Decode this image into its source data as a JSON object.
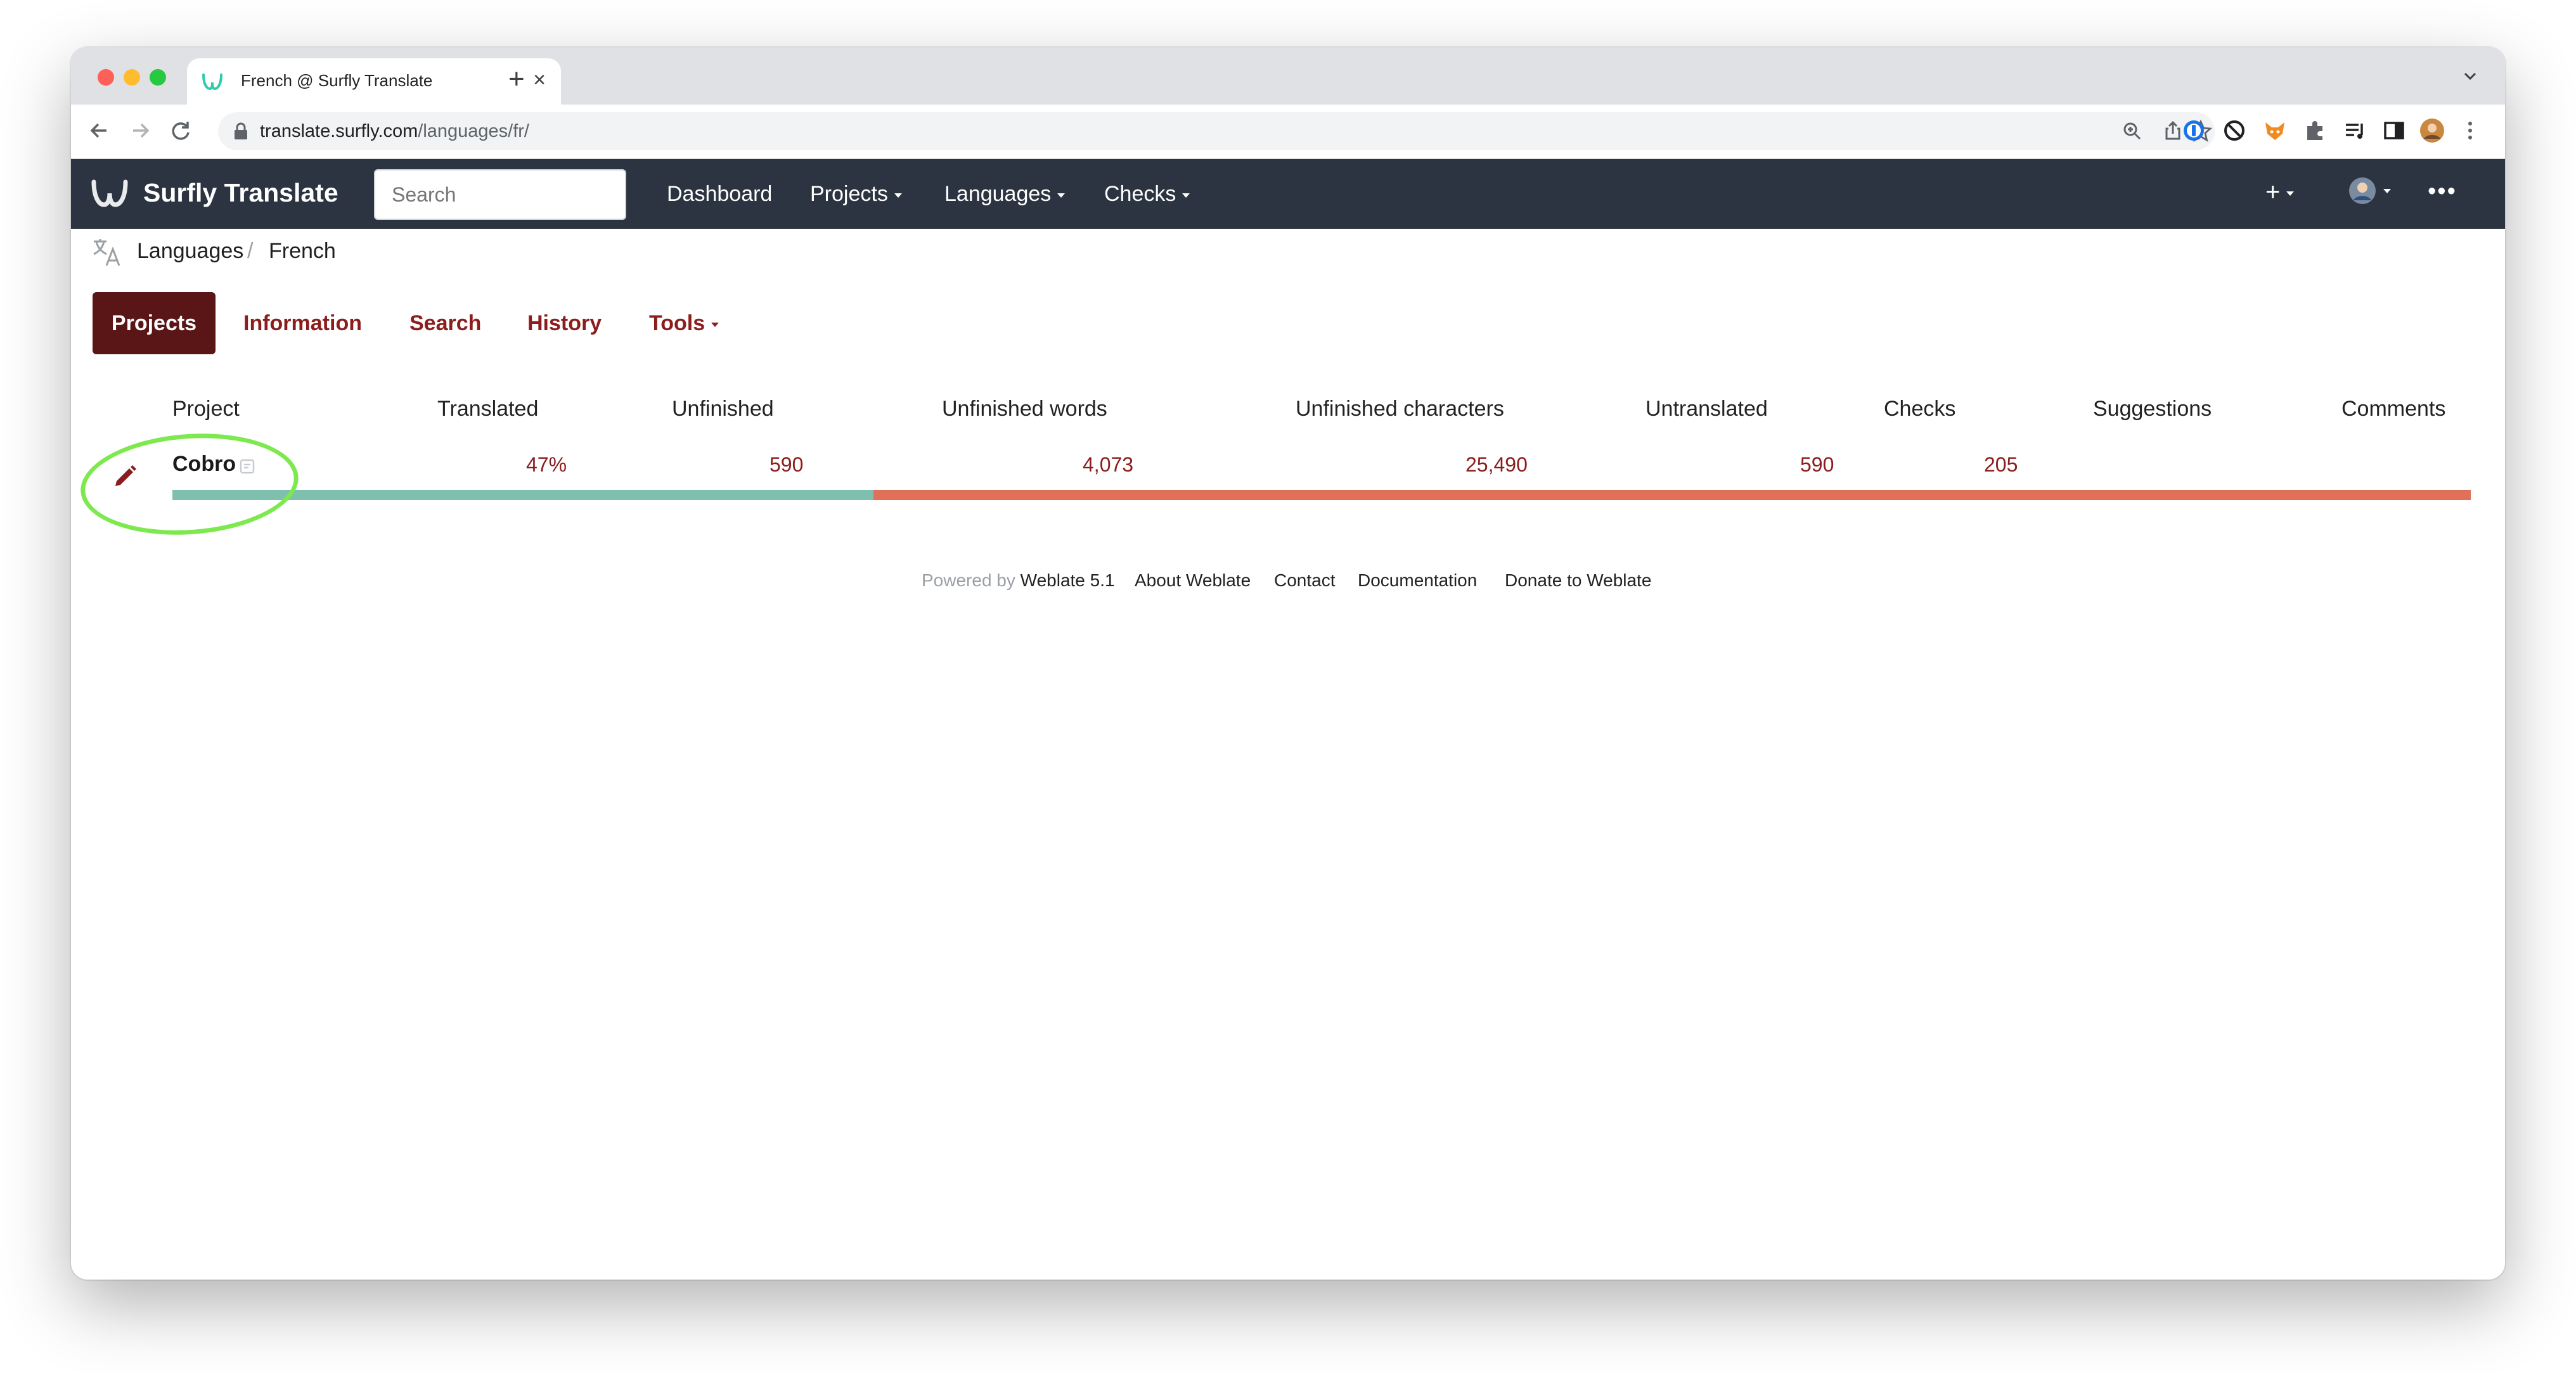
{
  "browser": {
    "tab_title": "French @ Surfly Translate",
    "new_tab": "+",
    "close": "×",
    "url_host": "translate.surfly.com",
    "url_path": "/languages/fr/"
  },
  "app": {
    "brand": "Surfly Translate",
    "search_placeholder": "Search",
    "nav": [
      {
        "label": "Dashboard"
      },
      {
        "label": "Projects"
      },
      {
        "label": "Languages"
      },
      {
        "label": "Checks"
      }
    ],
    "add": "+",
    "more": "•••"
  },
  "breadcrumb": {
    "items": [
      "Languages",
      "French"
    ],
    "separator": "/"
  },
  "subtabs": [
    {
      "label": "Projects",
      "active": true
    },
    {
      "label": "Information"
    },
    {
      "label": "Search"
    },
    {
      "label": "History"
    },
    {
      "label": "Tools"
    }
  ],
  "table": {
    "headers": [
      "Project",
      "Translated",
      "Unfinished",
      "Unfinished words",
      "Unfinished characters",
      "Untranslated",
      "Checks",
      "Suggestions",
      "Comments"
    ],
    "rows": [
      {
        "project": "Cobro",
        "translated": "47%",
        "unfinished": "590",
        "unfinished_words": "4,073",
        "unfinished_characters": "25,490",
        "untranslated": "590",
        "checks": "205",
        "suggestions": "",
        "comments": "",
        "progress_translated": 0.305
      }
    ]
  },
  "footer": {
    "powered_by": "Powered by",
    "weblate": "Weblate 5.1",
    "links": [
      "About Weblate",
      "Contact",
      "Documentation",
      "Donate to Weblate"
    ]
  },
  "colors": {
    "navbar": "#2b3440",
    "accent": "#8b1d1d",
    "active_tab": "#5a1616",
    "bar_done": "#7fbfad",
    "bar_todo": "#e07057",
    "highlight": "#7ee94f"
  }
}
